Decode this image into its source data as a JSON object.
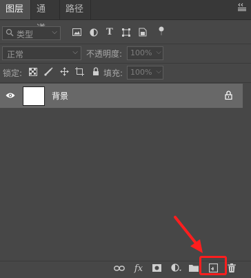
{
  "tabs": [
    {
      "label": "图层",
      "active": true
    },
    {
      "label": "通道",
      "active": false
    },
    {
      "label": "路径",
      "active": false
    }
  ],
  "filter": {
    "kind_label": "类型"
  },
  "blend": {
    "mode": "正常",
    "opacity_label": "不透明度:",
    "opacity_value": "100%"
  },
  "lock_row": {
    "lock_label": "锁定:",
    "fill_label": "填充:",
    "fill_value": "100%"
  },
  "layers": [
    {
      "name": "背景",
      "visible": true,
      "locked": true,
      "selected": true
    }
  ],
  "bottom": {
    "fx_label": "fx"
  },
  "colors": {
    "panel": "#474747",
    "tabbar": "#383838",
    "selected_row": "#686868",
    "annotation": "#ff1e1e"
  },
  "icons": [
    "menu-icon",
    "search-icon",
    "pixel-filter-icon",
    "adjustment-filter-icon",
    "type-filter-icon",
    "shape-filter-icon",
    "smart-object-filter-icon",
    "filter-toggle-icon",
    "lock-transparent-icon",
    "lock-pixels-icon",
    "lock-position-icon",
    "lock-artboard-icon",
    "lock-all-icon",
    "eye-icon",
    "lock-icon",
    "link-icon",
    "fx-icon",
    "mask-icon",
    "adjustment-icon",
    "folder-icon",
    "new-layer-icon",
    "trash-icon"
  ]
}
